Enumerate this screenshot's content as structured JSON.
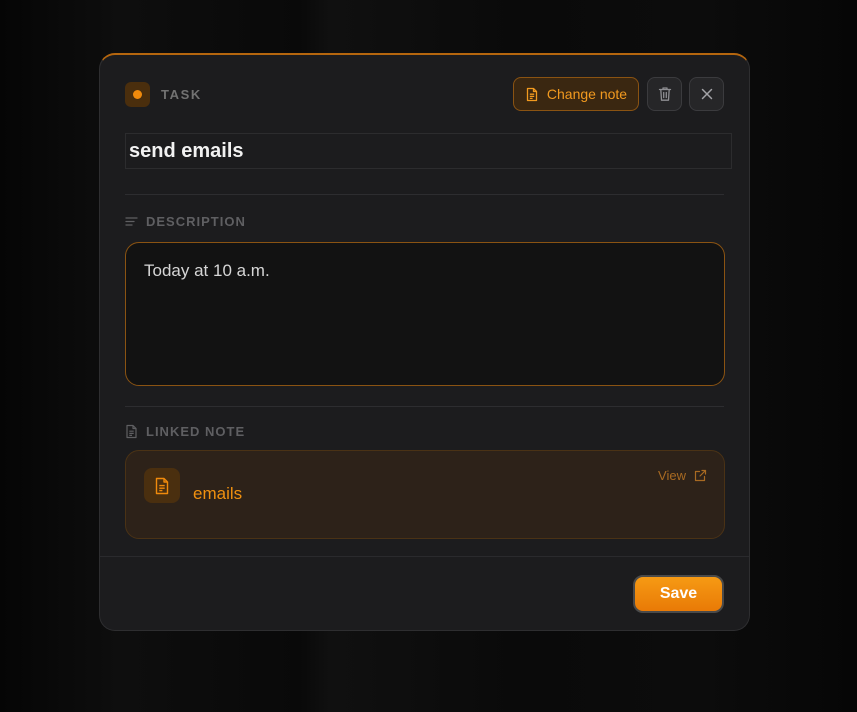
{
  "header": {
    "label": "TASK",
    "change_note_label": "Change note"
  },
  "task": {
    "title": "send emails"
  },
  "description": {
    "label": "DESCRIPTION",
    "text": "Today at 10 a.m."
  },
  "linked_note": {
    "label": "LINKED NOTE",
    "name": "emails",
    "view_label": "View"
  },
  "footer": {
    "save_label": "Save"
  },
  "icons": {
    "task_status": "dot-icon",
    "change_note": "document-icon",
    "delete": "trash-icon",
    "close": "close-icon",
    "description": "text-lines-icon",
    "linked_note": "document-icon",
    "note": "document-icon",
    "view": "external-link-icon"
  },
  "colors": {
    "accent": "#f08a0c",
    "background": "#1c1c1e",
    "text": "#f2f2f2"
  }
}
